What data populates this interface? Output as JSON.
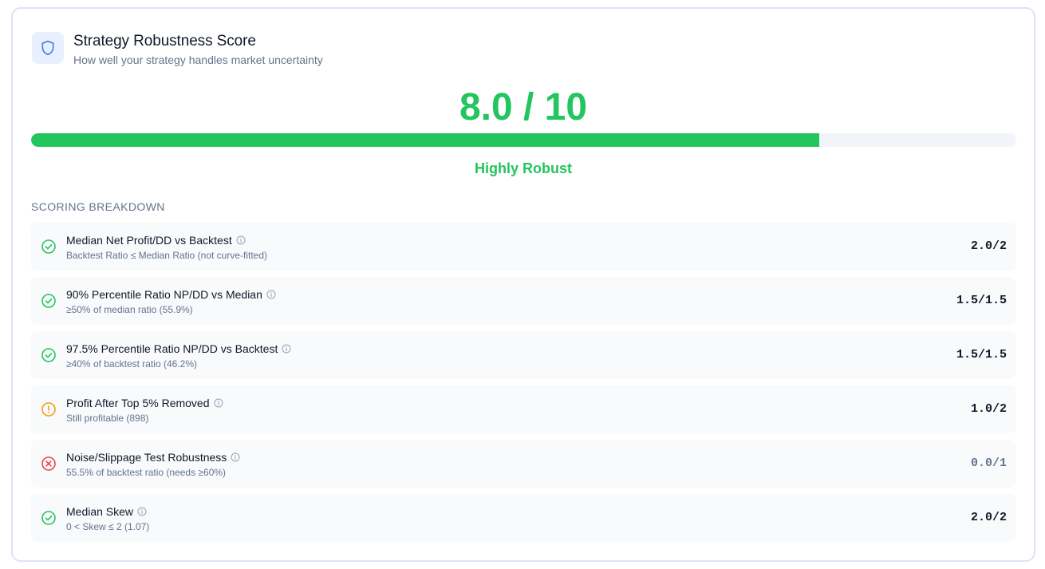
{
  "header": {
    "icon": "shield-icon",
    "title": "Strategy Robustness Score",
    "subtitle": "How well your strategy handles market uncertainty"
  },
  "score": {
    "text": "8.0 / 10",
    "value": 8.0,
    "max": 10,
    "verdict": "Highly Robust",
    "color": "#22c55e"
  },
  "breakdown": {
    "title": "SCORING BREAKDOWN",
    "items": [
      {
        "status": "pass",
        "icon": "check-circle-icon",
        "label": "Median Net Profit/DD vs Backtest",
        "detail": "Backtest Ratio ≤ Median Ratio (not curve-fitted)",
        "score": "2.0/2"
      },
      {
        "status": "pass",
        "icon": "check-circle-icon",
        "label": "90% Percentile Ratio NP/DD vs Median",
        "detail": "≥50% of median ratio (55.9%)",
        "score": "1.5/1.5"
      },
      {
        "status": "pass",
        "icon": "check-circle-icon",
        "label": "97.5% Percentile Ratio NP/DD vs Backtest",
        "detail": "≥40% of backtest ratio (46.2%)",
        "score": "1.5/1.5"
      },
      {
        "status": "warn",
        "icon": "alert-circle-icon",
        "label": "Profit After Top 5% Removed",
        "detail": "Still profitable (898)",
        "score": "1.0/2"
      },
      {
        "status": "fail",
        "icon": "x-circle-icon",
        "label": "Noise/Slippage Test Robustness",
        "detail": "55.5% of backtest ratio (needs ≥60%)",
        "score": "0.0/1"
      },
      {
        "status": "pass",
        "icon": "check-circle-icon",
        "label": "Median Skew",
        "detail": "0 < Skew ≤ 2 (1.07)",
        "score": "2.0/2"
      }
    ]
  },
  "colors": {
    "pass": "#22c55e",
    "warn": "#f59e0b",
    "fail": "#ef4444",
    "accent": "#3b82f6"
  }
}
